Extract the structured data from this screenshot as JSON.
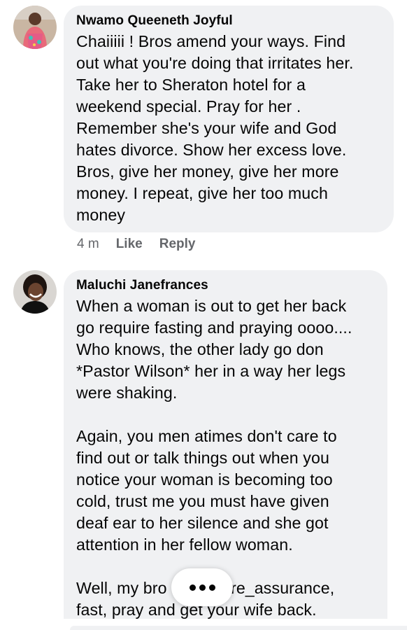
{
  "comments": [
    {
      "author": "Nwamo Queeneth Joyful",
      "text": "Chaiiiii ! Bros amend your ways. Find\nout what you're doing that irritates her.\nTake her to Sheraton hotel for a\nweekend special. Pray for her .\nRemember she's your wife and God\nhates divorce. Show her excess love.\nBros, give her money, give her more\nmoney. I repeat, give her too much\nmoney",
      "time": "4 m",
      "like_label": "Like",
      "reply_label": "Reply"
    },
    {
      "author": "Maluchi Janefrances",
      "text": "When a woman is out to get her back\ngo require fasting and praying oooo....\nWho knows, the other lady go don\n*Pastor Wilson* her in a way her legs\nwere shaking.\n\nAgain, you men atimes don't care to\nfind out or talk things out when you\nnotice your woman is becoming too\ncold, trust me you must have given\ndeaf ear to her silence and she got\nattention in her fellow woman.\n\nWell, my bro        Try re_assurance,\nfast, pray and get your wife back."
    }
  ],
  "colors": {
    "bubble": "#f0f1f3",
    "meta_text": "#65676b",
    "text": "#050505"
  },
  "icons": {
    "more": "more-dots-icon"
  }
}
